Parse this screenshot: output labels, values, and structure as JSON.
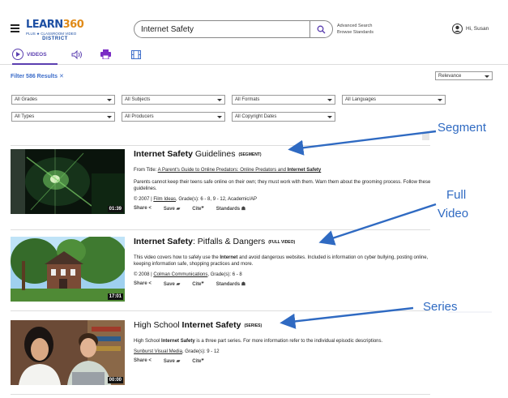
{
  "header": {
    "logo_main": "LEARN",
    "logo_num": "360",
    "logo_plus": "PLUS ★ CLASSROOM VIDEO",
    "logo_district": "DISTRICT",
    "search_value": "Internet Safety",
    "advanced_search": "Advanced Search",
    "browse_standards": "Browse Standards",
    "user_name": "Hi, Susan"
  },
  "tabs": {
    "videos_label": "VIDEOS",
    "icons": [
      "video-icon",
      "audio-icon",
      "print-icon",
      "film-icon"
    ],
    "accent": "#5b3fb0"
  },
  "filters": {
    "results_text": "Filter 586 Results",
    "clear_symbol": "✕",
    "sort": "Relevance",
    "grades": "All Grades",
    "subjects": "All Subjects",
    "formats": "All Formats",
    "languages": "All Languages",
    "types": "All Types",
    "producers": "All Producers",
    "copyright": "All Copyright Dates"
  },
  "actions": {
    "share": "Share",
    "save": "Save",
    "cite": "Cite",
    "standards": "Standards"
  },
  "results": [
    {
      "title_bold": "Internet Safety",
      "title_rest": " Guidelines",
      "badge": "(SEGMENT)",
      "from_prefix": "From Title: ",
      "from_link_a": "A Parent's Guide to Online Predators: Online Predators and ",
      "from_link_b": "Internet Safety",
      "description": "Parents cannot keep their teens safe online on their own; they must work with them. Warn them about the grooming process. Follow these guidelines.",
      "meta_prefix": "© 2007 | ",
      "meta_link": "Film Ideas",
      "meta_suffix": ", Grade(s): 6 - 8, 9 - 12, Academic/AP",
      "duration": "01:39"
    },
    {
      "title_bold": "Internet Safety",
      "title_rest": ": Pitfalls & Dangers",
      "badge": "(FULL VIDEO)",
      "desc_a": "This video covers how to safely use the ",
      "desc_b": "Internet",
      "desc_c": " and avoid dangerous websites. Included is information on cyber bullying, posting online, keeping information safe, shopping practices and more.",
      "meta_prefix": "© 2008 | ",
      "meta_link": "Colman Communications",
      "meta_suffix": ", Grade(s): 6 - 8",
      "duration": "17:01"
    },
    {
      "title_a": "High School ",
      "title_bold": "Internet Safety",
      "badge": "(SERIES)",
      "desc_a": "High School ",
      "desc_b": "Internet Safety",
      "desc_c": " is a three part series. For more information refer to the individual episodic descriptions.",
      "meta_link": "Sunburst Visual Media",
      "meta_suffix": ", Grade(s): 9 - 12",
      "duration": "00:00"
    }
  ],
  "annotations": {
    "segment": "Segment",
    "full": "Full",
    "video": "Video",
    "series": "Series",
    "color": "#2f6ac2"
  }
}
